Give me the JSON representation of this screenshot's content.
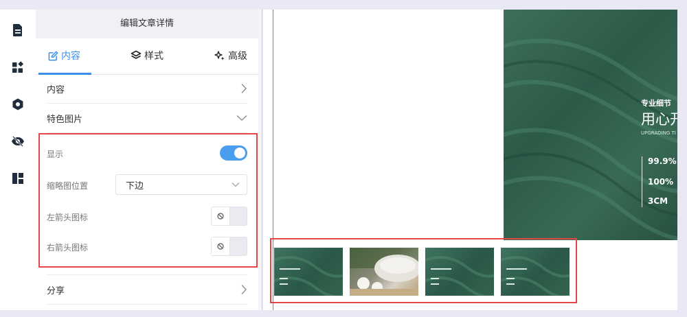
{
  "rail": {
    "icons": [
      "document-icon",
      "widgets-icon",
      "hexagon-icon",
      "eye-off-icon",
      "layout-icon"
    ]
  },
  "panel": {
    "title": "编辑文章详情",
    "tabs": [
      {
        "label": "内容",
        "icon": "edit-icon",
        "active": true
      },
      {
        "label": "样式",
        "icon": "layers-icon",
        "active": false
      },
      {
        "label": "高级",
        "icon": "sparkle-icon",
        "active": false
      }
    ],
    "sections": {
      "content": "内容",
      "featured_image": "特色图片",
      "share": "分享"
    },
    "featured": {
      "show_label": "显示",
      "show_enabled": true,
      "thumb_position_label": "缩略图位置",
      "thumb_position_value": "下边",
      "left_arrow_label": "左箭头图标",
      "right_arrow_label": "右箭头图标"
    }
  },
  "preview": {
    "hero": {
      "line1": "专业细节",
      "line2": "用心开",
      "line3": "UPGRADING TI",
      "stats": [
        "99.9%",
        "100%",
        "3CM"
      ]
    },
    "thumbnails": [
      "green",
      "cotton",
      "green",
      "green"
    ]
  },
  "colors": {
    "accent": "#3a8ee6",
    "highlight": "#e64545"
  }
}
